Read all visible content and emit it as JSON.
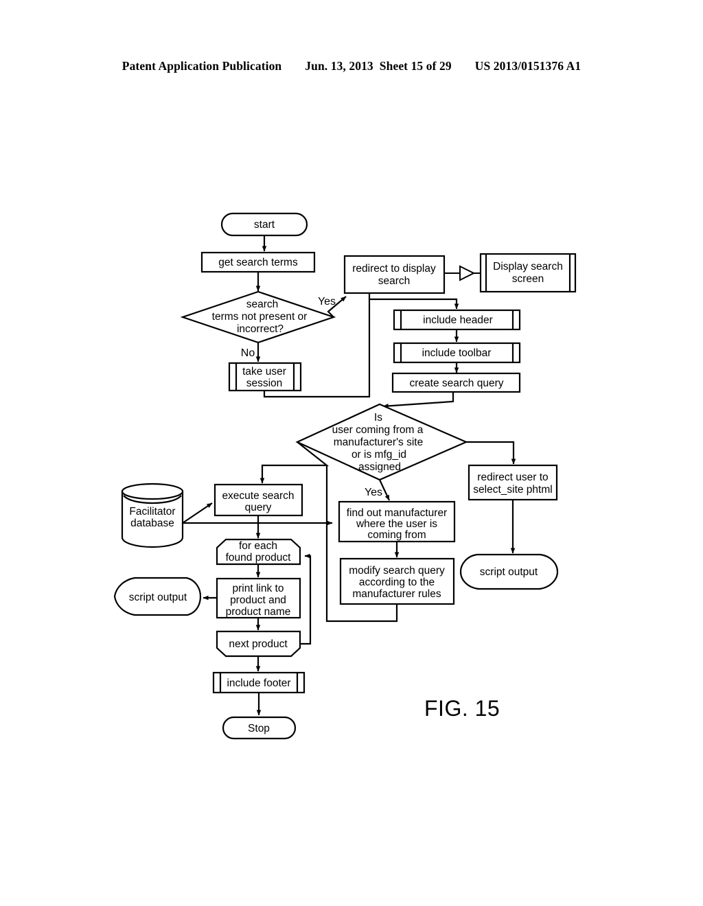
{
  "header": {
    "publication": "Patent Application Publication",
    "date": "Jun. 13, 2013",
    "sheet": "Sheet 15 of 29",
    "number": "US 2013/0151376 A1"
  },
  "figure": {
    "caption": "FIG. 15"
  },
  "chart_data": {
    "type": "diagram",
    "diagram_type": "flowchart",
    "title": "FIG. 15",
    "nodes": [
      {
        "id": "start",
        "shape": "terminator",
        "label": "start"
      },
      {
        "id": "get_terms",
        "shape": "process",
        "label": "get search terms"
      },
      {
        "id": "terms_decision",
        "shape": "decision",
        "label": "search terms not present or incorrect?"
      },
      {
        "id": "redirect_display",
        "shape": "process",
        "label": "redirect to display search"
      },
      {
        "id": "display_screen",
        "shape": "display",
        "label": "Display search screen"
      },
      {
        "id": "include_header",
        "shape": "predefined-process",
        "label": "include header"
      },
      {
        "id": "include_toolbar",
        "shape": "predefined-process",
        "label": "include toolbar"
      },
      {
        "id": "create_query",
        "shape": "process",
        "label": "create search query"
      },
      {
        "id": "take_session",
        "shape": "predefined-process",
        "label": "take user session"
      },
      {
        "id": "mfg_decision",
        "shape": "decision",
        "label": "Is user coming from a manufacturer's site or is mfg_id assigned"
      },
      {
        "id": "redirect_select",
        "shape": "process",
        "label": "redirect user to select_site phtml"
      },
      {
        "id": "script_out_right",
        "shape": "output",
        "label": "script output"
      },
      {
        "id": "find_mfg",
        "shape": "process",
        "label": "find out manufacturer where the user is coming from"
      },
      {
        "id": "modify_query",
        "shape": "process",
        "label": "modify search query according to the manufacturer rules"
      },
      {
        "id": "facilitator_db",
        "shape": "database",
        "label": "Facilitator database"
      },
      {
        "id": "execute_query",
        "shape": "process",
        "label": "execute search query"
      },
      {
        "id": "for_each",
        "shape": "loop-start",
        "label": "for each found product"
      },
      {
        "id": "print_link",
        "shape": "process",
        "label": "print link to product and product name"
      },
      {
        "id": "script_out_left",
        "shape": "output",
        "label": "script output"
      },
      {
        "id": "next_product",
        "shape": "loop-end",
        "label": "next product"
      },
      {
        "id": "include_footer",
        "shape": "predefined-process",
        "label": "include footer"
      },
      {
        "id": "stop",
        "shape": "terminator",
        "label": "Stop"
      }
    ],
    "edges": [
      {
        "from": "start",
        "to": "get_terms",
        "label": ""
      },
      {
        "from": "get_terms",
        "to": "terms_decision",
        "label": ""
      },
      {
        "from": "terms_decision",
        "to": "redirect_display",
        "label": "Yes"
      },
      {
        "from": "terms_decision",
        "to": "take_session",
        "label": "No"
      },
      {
        "from": "redirect_display",
        "to": "display_screen",
        "label": ""
      },
      {
        "from": "redirect_display",
        "to": "include_header",
        "label": ""
      },
      {
        "from": "take_session",
        "to": "include_header",
        "label": ""
      },
      {
        "from": "include_header",
        "to": "include_toolbar",
        "label": ""
      },
      {
        "from": "include_toolbar",
        "to": "create_query",
        "label": ""
      },
      {
        "from": "create_query",
        "to": "mfg_decision",
        "label": ""
      },
      {
        "from": "mfg_decision",
        "to": "find_mfg",
        "label": "Yes"
      },
      {
        "from": "mfg_decision",
        "to": "redirect_select",
        "label": ""
      },
      {
        "from": "mfg_decision",
        "to": "execute_query",
        "label": ""
      },
      {
        "from": "redirect_select",
        "to": "script_out_right",
        "label": ""
      },
      {
        "from": "find_mfg",
        "to": "modify_query",
        "label": ""
      },
      {
        "from": "modify_query",
        "to": "execute_query",
        "label": ""
      },
      {
        "from": "facilitator_db",
        "to": "execute_query",
        "label": ""
      },
      {
        "from": "facilitator_db",
        "to": "find_mfg",
        "label": ""
      },
      {
        "from": "execute_query",
        "to": "for_each",
        "label": ""
      },
      {
        "from": "for_each",
        "to": "print_link",
        "label": ""
      },
      {
        "from": "print_link",
        "to": "script_out_left",
        "label": ""
      },
      {
        "from": "print_link",
        "to": "next_product",
        "label": ""
      },
      {
        "from": "next_product",
        "to": "for_each",
        "label": ""
      },
      {
        "from": "next_product",
        "to": "include_footer",
        "label": ""
      },
      {
        "from": "include_footer",
        "to": "stop",
        "label": ""
      }
    ],
    "edge_labels": [
      "Yes",
      "No",
      "Yes"
    ]
  },
  "nodes": {
    "start": {
      "label": "start"
    },
    "get_terms": {
      "label": "get search terms"
    },
    "terms_decision": {
      "l1": "search",
      "l2": "terms not present or",
      "l3": "incorrect?"
    },
    "redirect_display": {
      "l1": "redirect to display",
      "l2": "search"
    },
    "display_screen": {
      "l1": "Display search",
      "l2": "screen"
    },
    "include_header": {
      "label": "include header"
    },
    "include_toolbar": {
      "label": "include toolbar"
    },
    "create_query": {
      "label": "create search query"
    },
    "take_session": {
      "l1": "take user",
      "l2": "session"
    },
    "mfg_decision": {
      "l1": "Is",
      "l2": "user coming from a",
      "l3": "manufacturer's site",
      "l4": "or is mfg_id",
      "l5": "assigned"
    },
    "redirect_select": {
      "l1": "redirect user to",
      "l2": "select_site phtml"
    },
    "script_out_right": {
      "label": "script output"
    },
    "find_mfg": {
      "l1": "find out manufacturer",
      "l2": "where the user is",
      "l3": "coming from"
    },
    "modify_query": {
      "l1": "modify search query",
      "l2": "according to the",
      "l3": "manufacturer rules"
    },
    "facilitator_db": {
      "l1": "Facilitator",
      "l2": "database"
    },
    "execute_query": {
      "l1": "execute search",
      "l2": "query"
    },
    "for_each": {
      "l1": "for each",
      "l2": "found product"
    },
    "print_link": {
      "l1": "print link to",
      "l2": "product and",
      "l3": "product name"
    },
    "script_out_left": {
      "label": "script output"
    },
    "next_product": {
      "label": "next product"
    },
    "include_footer": {
      "label": "include footer"
    },
    "stop": {
      "label": "Stop"
    }
  },
  "labels": {
    "yes_terms": "Yes",
    "no_terms": "No",
    "yes_mfg": "Yes"
  }
}
